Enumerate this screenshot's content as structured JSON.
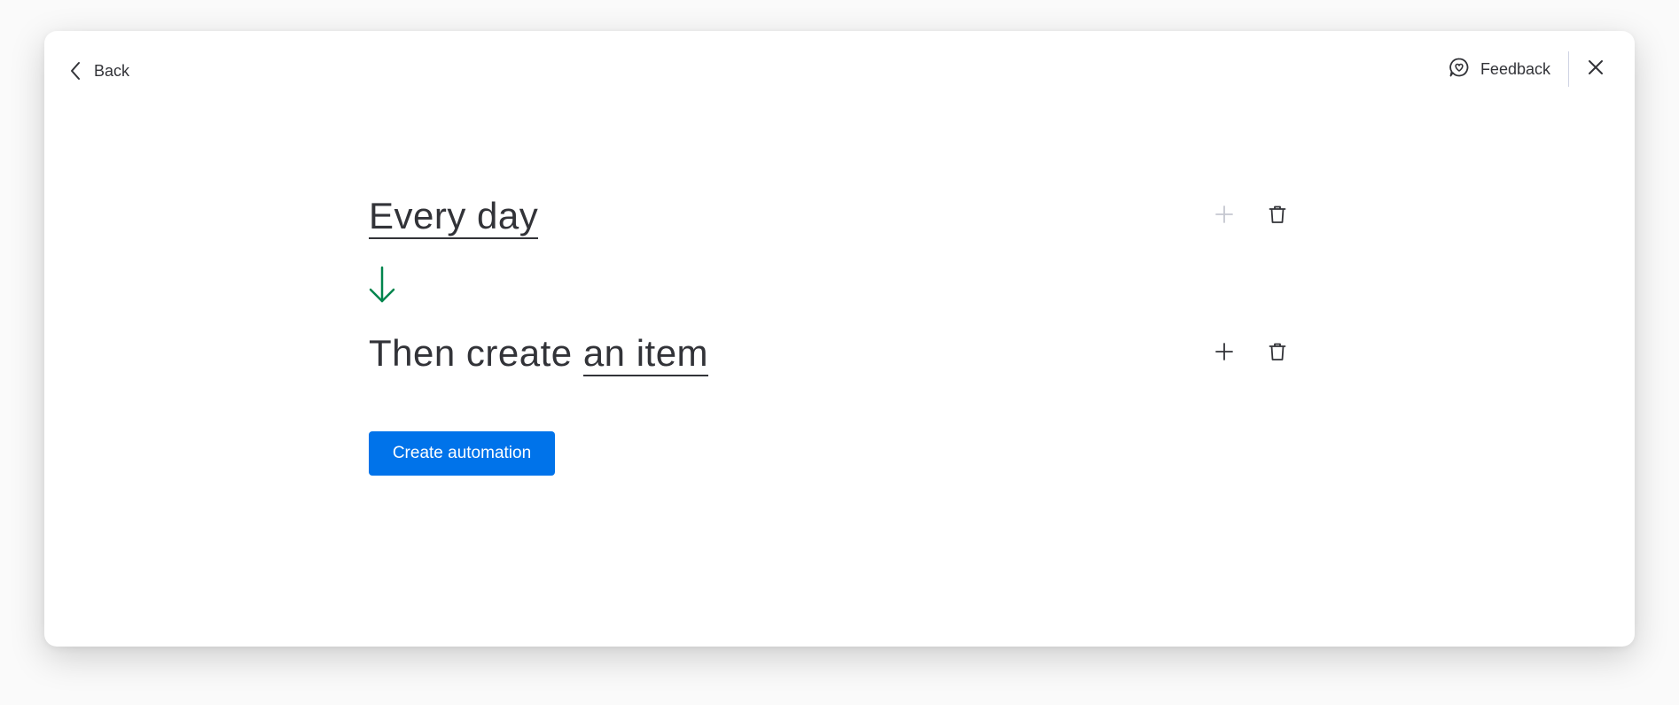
{
  "header": {
    "back_label": "Back",
    "feedback_label": "Feedback"
  },
  "recipe": {
    "trigger": {
      "text": "Every day"
    },
    "action": {
      "prefix": "Then create ",
      "object": "an item"
    }
  },
  "footer": {
    "create_label": "Create automation"
  },
  "icons": {
    "back": "chevron-left-icon",
    "feedback": "feedback-heart-bubble-icon",
    "close": "close-icon",
    "arrow": "arrow-down-icon",
    "add": "plus-icon",
    "delete": "trash-icon"
  },
  "colors": {
    "primary": "#0073ea",
    "arrow": "#00854d",
    "text": "#323338",
    "disabled_icon": "#c5c7d0"
  }
}
